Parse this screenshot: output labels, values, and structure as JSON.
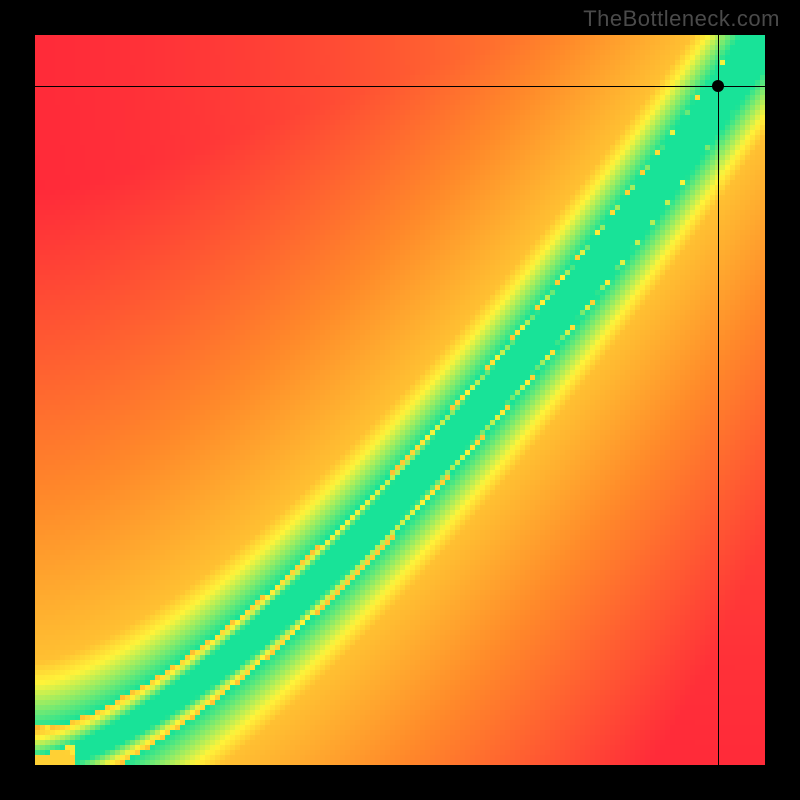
{
  "watermark": {
    "text": "TheBottleneck.com"
  },
  "chart_data": {
    "type": "heatmap",
    "title": "",
    "xlabel": "",
    "ylabel": "",
    "xlim": [
      0,
      1
    ],
    "ylim": [
      0,
      1
    ],
    "grid_resolution": 146,
    "field": {
      "description": "Distance from curve y = x^1.45 through unit square; color maps distance→red(far)→yellow(mid)→green(at curve). Slight gradient pulls toward yellow near top-right and bottom-left corners.",
      "curve_exponent": 1.45,
      "green_half_width": 0.045,
      "yellow_half_width": 0.14
    },
    "colors": {
      "red": "#ff2a3a",
      "orange": "#ff8a2a",
      "yellow": "#fff43a",
      "green": "#18e398"
    },
    "crosshair": {
      "x": 0.935,
      "y": 0.93
    },
    "marker": {
      "x": 0.935,
      "y": 0.93
    }
  }
}
